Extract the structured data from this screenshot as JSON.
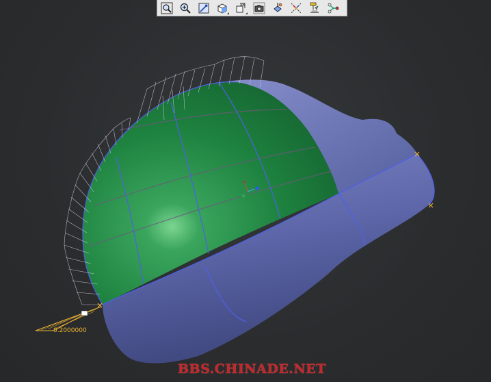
{
  "toolbar": {
    "buttons": [
      {
        "name": "zoom-fit-icon",
        "label": "Fit all"
      },
      {
        "name": "zoom-in-icon",
        "label": "Zoom in"
      },
      {
        "name": "normal-view-icon",
        "label": "Normal view"
      },
      {
        "name": "views-cube-icon",
        "label": "Views"
      },
      {
        "name": "render-style-icon",
        "label": "Render style"
      },
      {
        "name": "capture-icon",
        "label": "Capture"
      },
      {
        "name": "hide-show-icon",
        "label": "Hide/Show"
      },
      {
        "name": "axis-icon",
        "label": "Axis"
      },
      {
        "name": "compass-icon",
        "label": "Compass"
      },
      {
        "name": "connect-icon",
        "label": "Connect"
      }
    ]
  },
  "scene": {
    "param_value": "0.2000000",
    "colors": {
      "body": "#5c66a8",
      "patch": "#1f8a42",
      "highlight": "#78d28a",
      "edge": "#4f5fe8",
      "comb": "#c9c4dc",
      "label": "#f2b632"
    }
  },
  "watermark": {
    "text": "BBS.CHINADE.NET"
  }
}
